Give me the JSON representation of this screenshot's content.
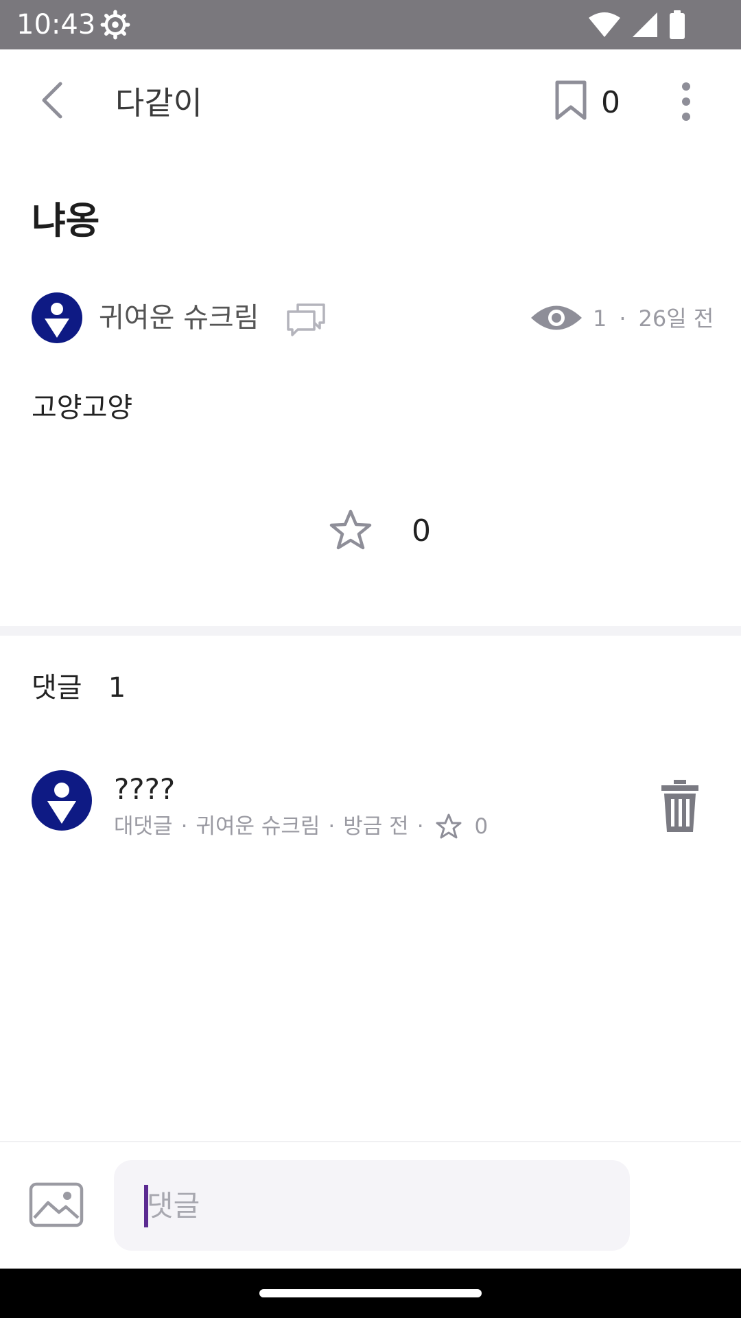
{
  "status_bar": {
    "time": "10:43",
    "icons": [
      "settings-gear-icon",
      "wifi-icon",
      "cellular-signal-icon",
      "battery-icon"
    ]
  },
  "app_bar": {
    "title": "다같이",
    "bookmark_count": "0",
    "icons": [
      "back-arrow-icon",
      "bookmark-icon",
      "more-vertical-icon"
    ]
  },
  "post": {
    "title": "냐옹",
    "author": "귀여운 슈크림",
    "views": "1",
    "separator": "·",
    "time_ago": "26일 전",
    "body": "고양고양",
    "like_count": "0"
  },
  "comments": {
    "label": "댓글",
    "count": "1",
    "items": [
      {
        "text": "????",
        "reply_label": "대댓글",
        "author": "귀여운 슈크림",
        "time_ago": "방금 전",
        "like_count": "0"
      }
    ]
  },
  "composer": {
    "placeholder": "댓글"
  },
  "colors": {
    "status_bar": "#7a787d",
    "avatar": "#0e1a84",
    "muted_text": "#9a9aa2",
    "icon_gray": "#8e8e98",
    "input_bg": "#f5f4f8",
    "caret": "#5b2a91"
  }
}
